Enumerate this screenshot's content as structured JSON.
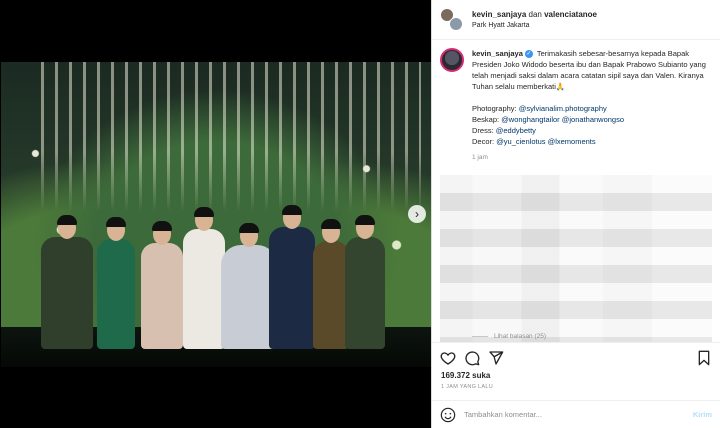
{
  "header": {
    "user1": "kevin_sanjaya",
    "joiner": "dan",
    "user2": "valenciatanoe",
    "location": "Park Hyatt Jakarta"
  },
  "caption": {
    "username": "kevin_sanjaya",
    "text": "Terimakasih sebesar-besarnya kepada Bapak Presiden Joko Widodo beserta ibu dan Bapak Prabowo Subianto yang telah menjadi saksi dalam acara catatan sipil saya dan Valen. Kiranya Tuhan selalu memberkati🙏",
    "credits": [
      {
        "label": "Photography: ",
        "handles": [
          "@sylvianalim.photography"
        ]
      },
      {
        "label": "Beskap: ",
        "handles": [
          "@wonghangtailor",
          "@jonathanwongso"
        ]
      },
      {
        "label": "Dress: ",
        "handles": [
          "@eddybetty"
        ]
      },
      {
        "label": "Decor: ",
        "handles": [
          "@yu_cienlotus",
          "@lxemoments"
        ]
      }
    ],
    "time": "1 jam"
  },
  "replies_label": "Lihat balasan (25)",
  "likes": "169.372 suka",
  "time_ago": "1 JAM YANG LALU",
  "comment_input": {
    "placeholder": "Tambahkan komentar..."
  },
  "post_label": "Kirim",
  "icons": {
    "like": "heart-icon",
    "comment": "comment-icon",
    "share": "share-icon",
    "save": "bookmark-icon",
    "emoji": "emoji-icon",
    "next": "chevron-right-icon"
  },
  "carousel": {
    "count": 6,
    "active": 0
  },
  "colors": {
    "link": "#00376b",
    "verified": "#3897f0",
    "post_disabled": "#b2dffc"
  }
}
